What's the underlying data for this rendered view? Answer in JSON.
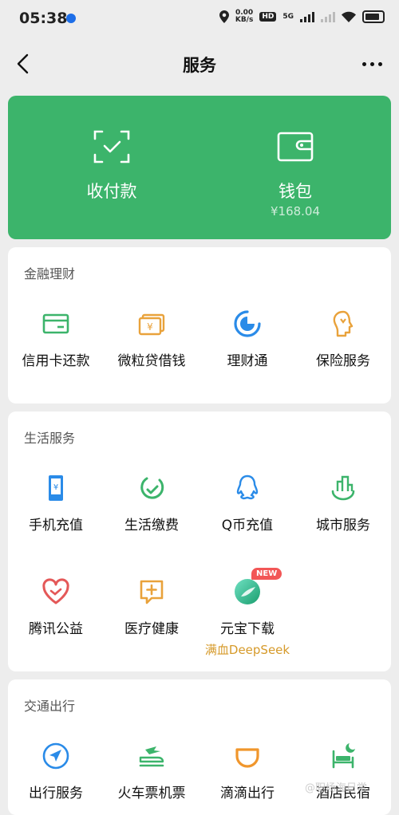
{
  "status_bar": {
    "time": "05:38",
    "speed_value": "0.00",
    "speed_unit": "KB/s",
    "hd": "HD",
    "network": "5G"
  },
  "nav": {
    "title": "服务"
  },
  "wallet_card": {
    "bg_color": "#3cb46b",
    "pay": {
      "label": "收付款",
      "icon": "scan-pay-icon"
    },
    "wallet": {
      "label": "钱包",
      "balance": "¥168.04",
      "icon": "wallet-icon"
    }
  },
  "finance": {
    "title": "金融理财",
    "items": [
      {
        "label": "信用卡还款",
        "icon": "credit-card-icon"
      },
      {
        "label": "微粒贷借钱",
        "icon": "loan-icon"
      },
      {
        "label": "理财通",
        "icon": "licaitong-icon"
      },
      {
        "label": "保险服务",
        "icon": "insurance-icon"
      }
    ]
  },
  "life": {
    "title": "生活服务",
    "items": [
      {
        "label": "手机充值",
        "icon": "mobile-topup-icon"
      },
      {
        "label": "生活缴费",
        "icon": "utility-bill-icon"
      },
      {
        "label": "Q币充值",
        "icon": "qq-coin-icon"
      },
      {
        "label": "城市服务",
        "icon": "city-service-icon"
      },
      {
        "label": "腾讯公益",
        "icon": "charity-icon"
      },
      {
        "label": "医疗健康",
        "icon": "medical-icon"
      },
      {
        "label": "元宝下载",
        "icon": "yuanbao-icon",
        "badge": "NEW",
        "sub": "满血DeepSeek"
      }
    ]
  },
  "transport": {
    "title": "交通出行",
    "items": [
      {
        "label": "出行服务",
        "icon": "travel-icon"
      },
      {
        "label": "火车票机票",
        "icon": "train-plane-icon"
      },
      {
        "label": "滴滴出行",
        "icon": "didi-icon"
      },
      {
        "label": "酒店民宿",
        "icon": "hotel-icon"
      }
    ]
  },
  "watermark": "@职场海日常"
}
